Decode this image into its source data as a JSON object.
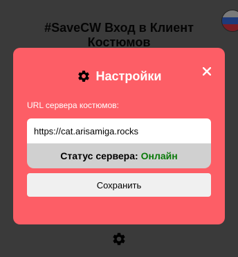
{
  "background": {
    "title": "#SaveCW Вход в Клиент Костюмов",
    "language_flag": "russian-flag-icon",
    "settings_icon": "gear-icon"
  },
  "modal": {
    "title": "Настройки",
    "title_icon": "gear-icon",
    "close_label": "×",
    "field_label": "URL сервера костюмов:",
    "url_value": "https://cat.arisamiga.rocks",
    "status_label": "Статус сервера:",
    "status_value": "Онлайн",
    "save_label": "Сохранить"
  },
  "colors": {
    "modal_bg": "#fd5e66",
    "status_ok": "#0a7a0a",
    "overlay": "#3a3a3a"
  }
}
